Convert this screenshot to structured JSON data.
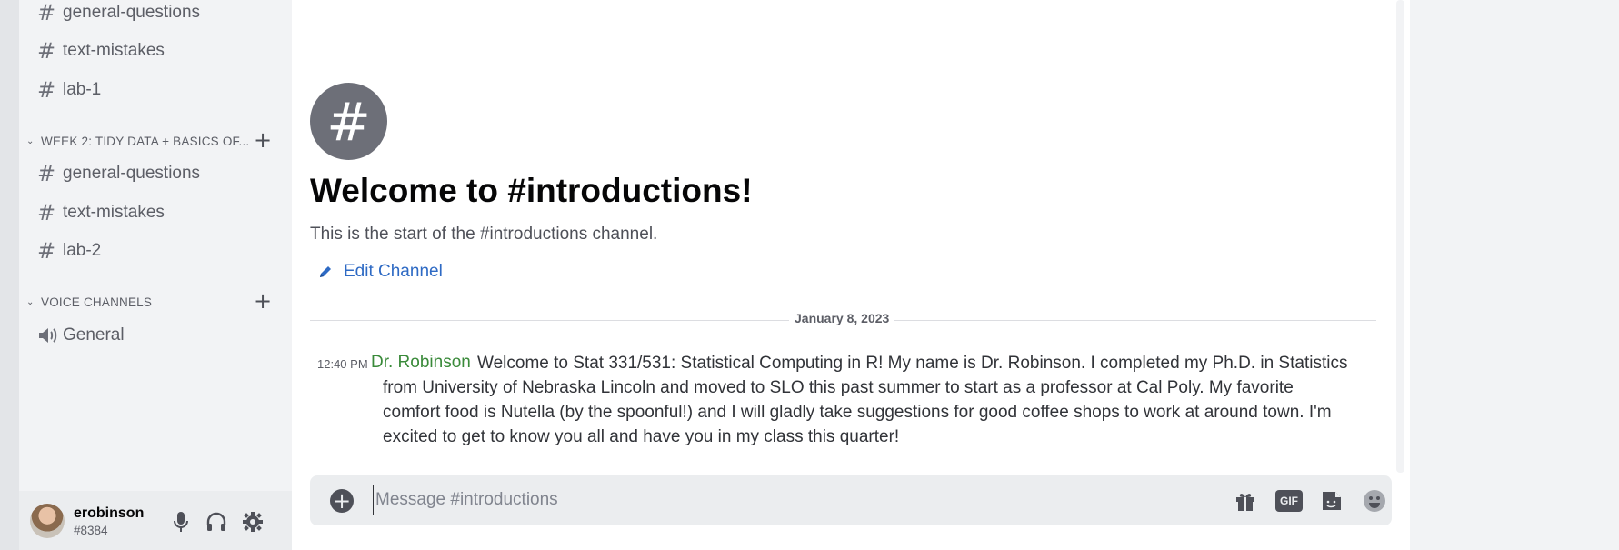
{
  "sidebar": {
    "week1_channels": [
      {
        "label": "general-questions"
      },
      {
        "label": "text-mistakes"
      },
      {
        "label": "lab-1"
      }
    ],
    "week2_category": "WEEK 2: TIDY DATA + BASICS OF...",
    "week2_channels": [
      {
        "label": "general-questions"
      },
      {
        "label": "text-mistakes"
      },
      {
        "label": "lab-2"
      }
    ],
    "voice_category": "VOICE CHANNELS",
    "voice_channels": [
      {
        "label": "General"
      }
    ]
  },
  "user": {
    "name": "erobinson",
    "tag": "#8384"
  },
  "channel_intro": {
    "icon_glyph": "#",
    "title": "Welcome to #introductions!",
    "subtitle": "This is the start of the #introductions channel.",
    "edit_label": "Edit Channel"
  },
  "date_divider": "January 8, 2023",
  "message": {
    "time": "12:40 PM",
    "author": "Dr. Robinson",
    "text": "Welcome to Stat 331/531: Statistical Computing in R! My name is Dr. Robinson. I completed my Ph.D. in Statistics from University of Nebraska Lincoln and moved to SLO this past summer to start as a professor at Cal Poly. My favorite comfort food is Nutella (by the spoonful!) and I will gladly take suggestions for good coffee shops to work at around town. I'm excited to get to know you all and have you in my class this quarter!"
  },
  "composer": {
    "placeholder": "Message #introductions",
    "gif_label": "GIF"
  },
  "colors": {
    "accent_link": "#2e6ac4",
    "author_green": "#3a8a3a",
    "sidebar_bg": "#f2f3f5"
  },
  "icons": [
    "hash-icon",
    "speaker-icon",
    "plus-icon",
    "chevron-down-icon",
    "microphone-icon",
    "headphones-icon",
    "gear-icon",
    "pencil-icon",
    "gift-icon",
    "gif-icon",
    "sticker-icon",
    "emoji-icon"
  ]
}
